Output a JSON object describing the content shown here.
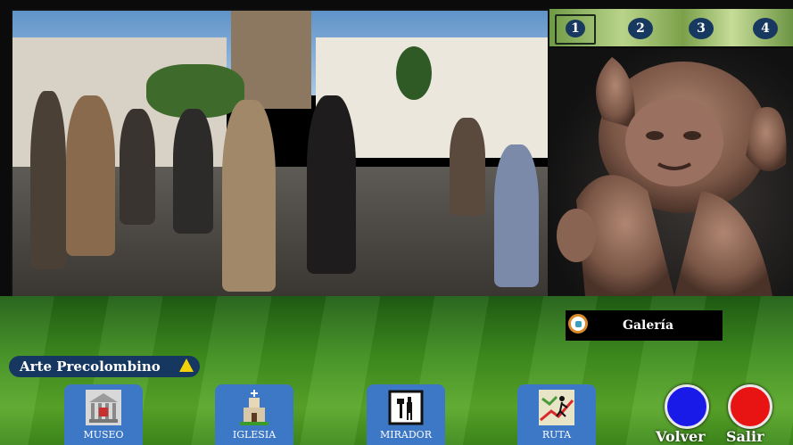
{
  "thumbnails": [
    "1",
    "2",
    "3",
    "4"
  ],
  "selected_thumbnail": "1",
  "gallery": {
    "label": "Galería",
    "icon": "gallery-icon"
  },
  "section": {
    "label": "Arte Precolombino",
    "icon": "warning-triangle-icon"
  },
  "nav": {
    "museo": "MUSEO",
    "iglesia": "IGLESIA",
    "mirador": "MIRADOR",
    "ruta": "RUTA"
  },
  "controls": {
    "volver": "Volver",
    "salir": "Salir"
  },
  "colors": {
    "nav_button": "#3d78c6",
    "volver": "#1a1ae8",
    "salir": "#e81414",
    "label_bar": "#16375f",
    "warning": "#f4d20a"
  }
}
